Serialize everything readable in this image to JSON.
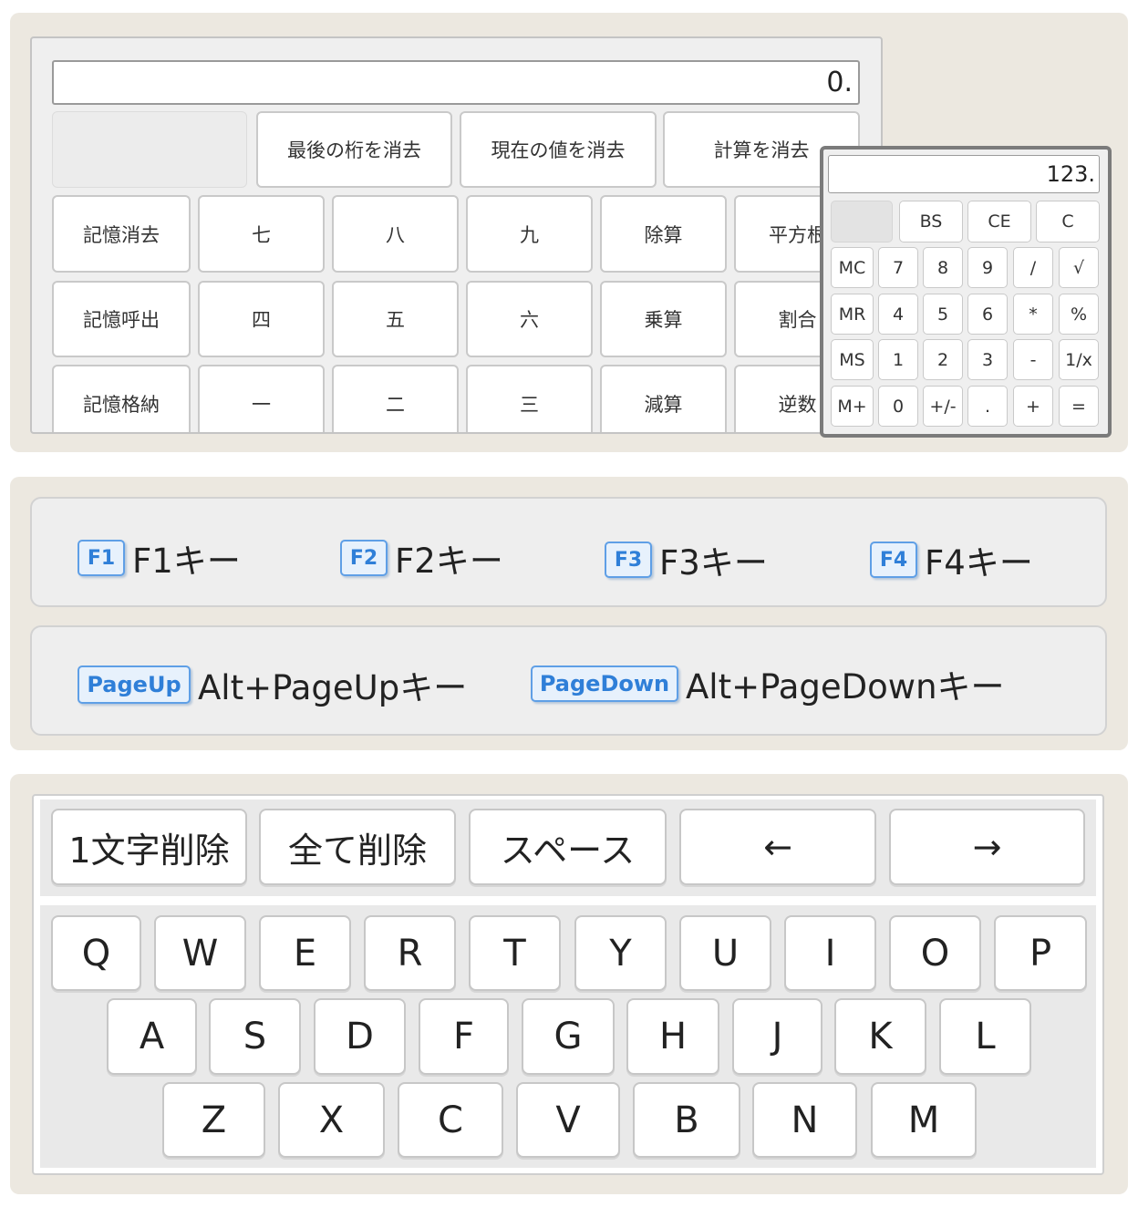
{
  "calculator_large": {
    "display": "0.",
    "top_row": [
      "最後の桁を消去",
      "現在の値を消去",
      "計算を消去"
    ],
    "rows": [
      [
        "記憶消去",
        "七",
        "八",
        "九",
        "除算",
        "平方根"
      ],
      [
        "記憶呼出",
        "四",
        "五",
        "六",
        "乗算",
        "割合"
      ],
      [
        "記憶格納",
        "一",
        "二",
        "三",
        "減算",
        "逆数"
      ]
    ]
  },
  "calculator_small": {
    "display": "123.",
    "top_row": [
      "BS",
      "CE",
      "C"
    ],
    "rows": [
      [
        "MC",
        "7",
        "8",
        "9",
        "/",
        "√"
      ],
      [
        "MR",
        "4",
        "5",
        "6",
        "*",
        "%"
      ],
      [
        "MS",
        "1",
        "2",
        "3",
        "-",
        "1/x"
      ],
      [
        "M+",
        "0",
        "+/-",
        ".",
        "+",
        "="
      ]
    ]
  },
  "function_keys": [
    {
      "cap": "F1",
      "label": "F1キー"
    },
    {
      "cap": "F2",
      "label": "F2キー"
    },
    {
      "cap": "F3",
      "label": "F3キー"
    },
    {
      "cap": "F4",
      "label": "F4キー"
    }
  ],
  "page_keys": [
    {
      "cap": "PageUp",
      "label": "Alt+PageUpキー"
    },
    {
      "cap": "PageDown",
      "label": "Alt+PageDownキー"
    }
  ],
  "keyboard": {
    "controls": [
      "1文字削除",
      "全て削除",
      "スペース",
      "←",
      "→"
    ],
    "row1": [
      "Q",
      "W",
      "E",
      "R",
      "T",
      "Y",
      "U",
      "I",
      "O",
      "P"
    ],
    "row2": [
      "A",
      "S",
      "D",
      "F",
      "G",
      "H",
      "J",
      "K",
      "L"
    ],
    "row3": [
      "Z",
      "X",
      "C",
      "V",
      "B",
      "N",
      "M"
    ]
  }
}
